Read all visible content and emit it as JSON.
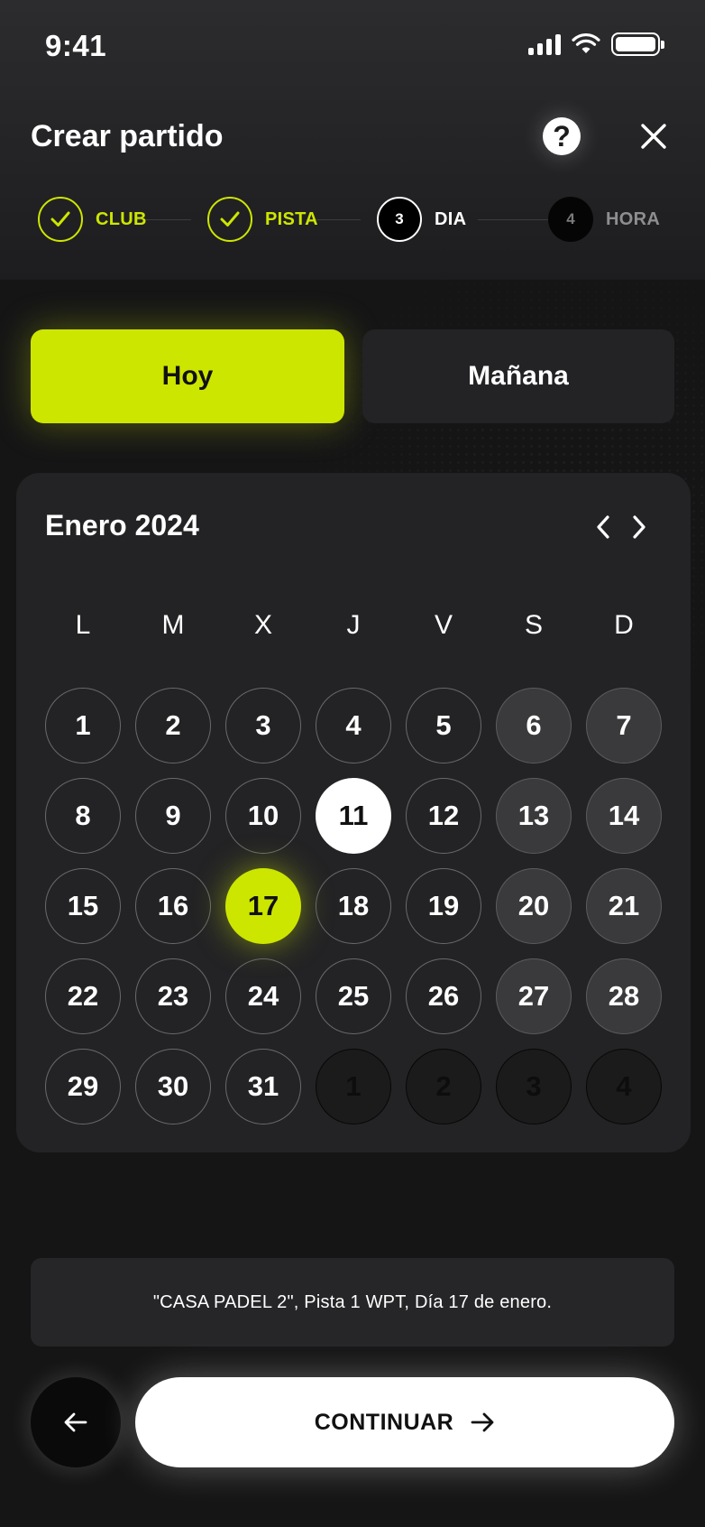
{
  "status_bar": {
    "time": "9:41"
  },
  "header": {
    "title": "Crear partido"
  },
  "stepper": {
    "steps": [
      {
        "number": "1",
        "label": "CLUB",
        "state": "done"
      },
      {
        "number": "2",
        "label": "PISTA",
        "state": "done"
      },
      {
        "number": "3",
        "label": "DIA",
        "state": "current"
      },
      {
        "number": "4",
        "label": "HORA",
        "state": "pending"
      }
    ]
  },
  "day_toggle": {
    "today": "Hoy",
    "tomorrow": "Mañana",
    "selected": "today"
  },
  "calendar": {
    "month": "Enero 2024",
    "weekdays": [
      "L",
      "M",
      "X",
      "J",
      "V",
      "S",
      "D"
    ],
    "today": "11",
    "selected": "17",
    "weeks": [
      [
        "1",
        "2",
        "3",
        "4",
        "5",
        "6",
        "7"
      ],
      [
        "8",
        "9",
        "10",
        "11",
        "12",
        "13",
        "14"
      ],
      [
        "15",
        "16",
        "17",
        "18",
        "19",
        "20",
        "21"
      ],
      [
        "22",
        "23",
        "24",
        "25",
        "26",
        "27",
        "28"
      ],
      [
        "29",
        "30",
        "31",
        "1",
        "2",
        "3",
        "4"
      ]
    ],
    "trailing_days": 4
  },
  "summary": {
    "text": "\"CASA PADEL 2\", Pista 1 WPT, Día 17 de enero."
  },
  "actions": {
    "continue_label": "CONTINUAR"
  },
  "colors": {
    "accent": "#cde600",
    "background": "#151516",
    "card": "#232325"
  },
  "icons": {
    "help": "question-icon",
    "close": "close-icon",
    "back": "arrow-left-icon",
    "continue": "arrow-right-icon"
  }
}
